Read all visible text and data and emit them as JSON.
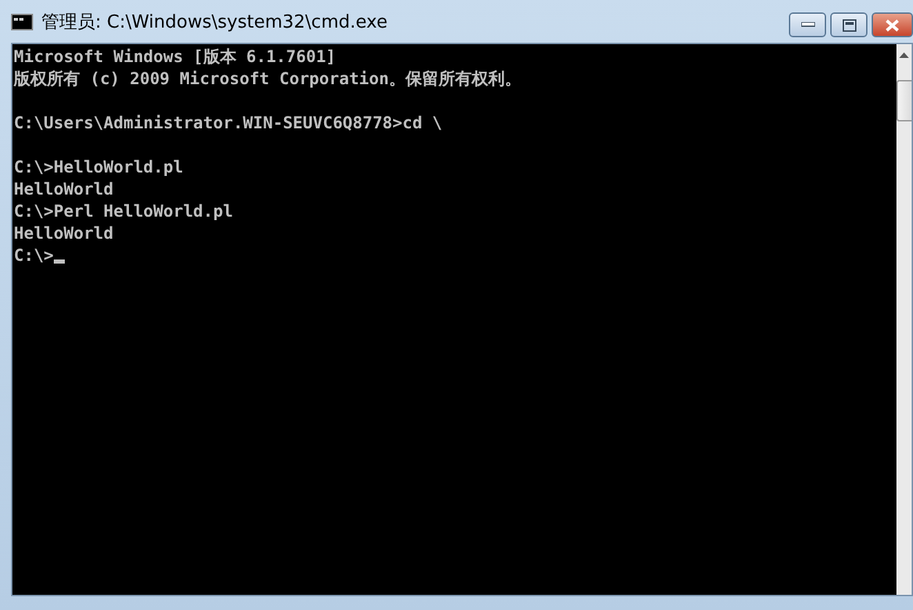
{
  "window": {
    "title": "管理员: C:\\Windows\\system32\\cmd.exe"
  },
  "console": {
    "blocks": [
      [
        "Microsoft Windows [版本 6.1.7601]",
        "版权所有 (c) 2009 Microsoft Corporation。保留所有权利。"
      ],
      [
        "C:\\Users\\Administrator.WIN-SEUVC6Q8778>cd \\"
      ],
      [
        "C:\\>HelloWorld.pl",
        "HelloWorld",
        "C:\\>Perl HelloWorld.pl",
        "HelloWorld",
        "C:\\>"
      ]
    ]
  }
}
